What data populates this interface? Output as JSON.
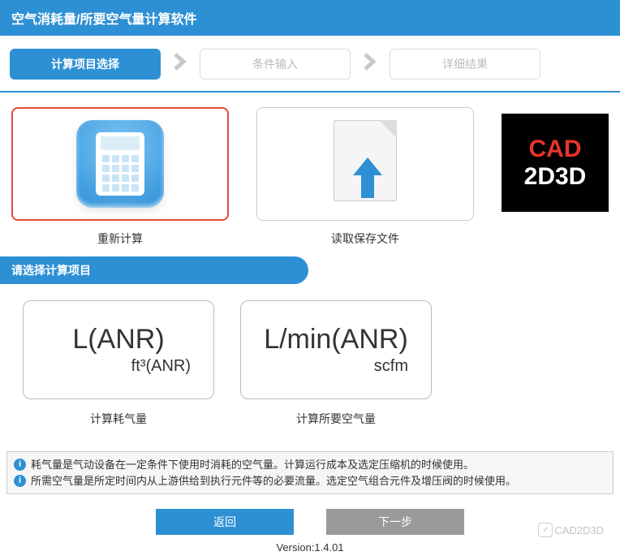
{
  "header": {
    "title": "空气消耗量/所要空气量计算软件"
  },
  "steps": {
    "s1": "计算项目选择",
    "s2": "条件输入",
    "s3": "详细结果"
  },
  "topCards": {
    "recalc": "重新计算",
    "loadFile": "读取保存文件"
  },
  "logo": {
    "line1": "CAD",
    "line2": "2D3D"
  },
  "sectionTitle": "请选择计算项目",
  "options": {
    "opt1": {
      "big": "L(ANR)",
      "small": "ft³(ANR)",
      "label": "计算耗气量"
    },
    "opt2": {
      "big": "L/min(ANR)",
      "small": "scfm",
      "label": "计算所要空气量"
    }
  },
  "info": {
    "l1": "耗气量是气动设备在一定条件下使用时消耗的空气量。计算运行成本及选定压缩机的时候使用。",
    "l2": "所需空气量是所定时间内从上游供给到执行元件等的必要流量。选定空气组合元件及增压阀的时候使用。"
  },
  "buttons": {
    "back": "返回",
    "next": "下一步"
  },
  "version": "Version:1.4.01",
  "watermark": "CAD2D3D"
}
